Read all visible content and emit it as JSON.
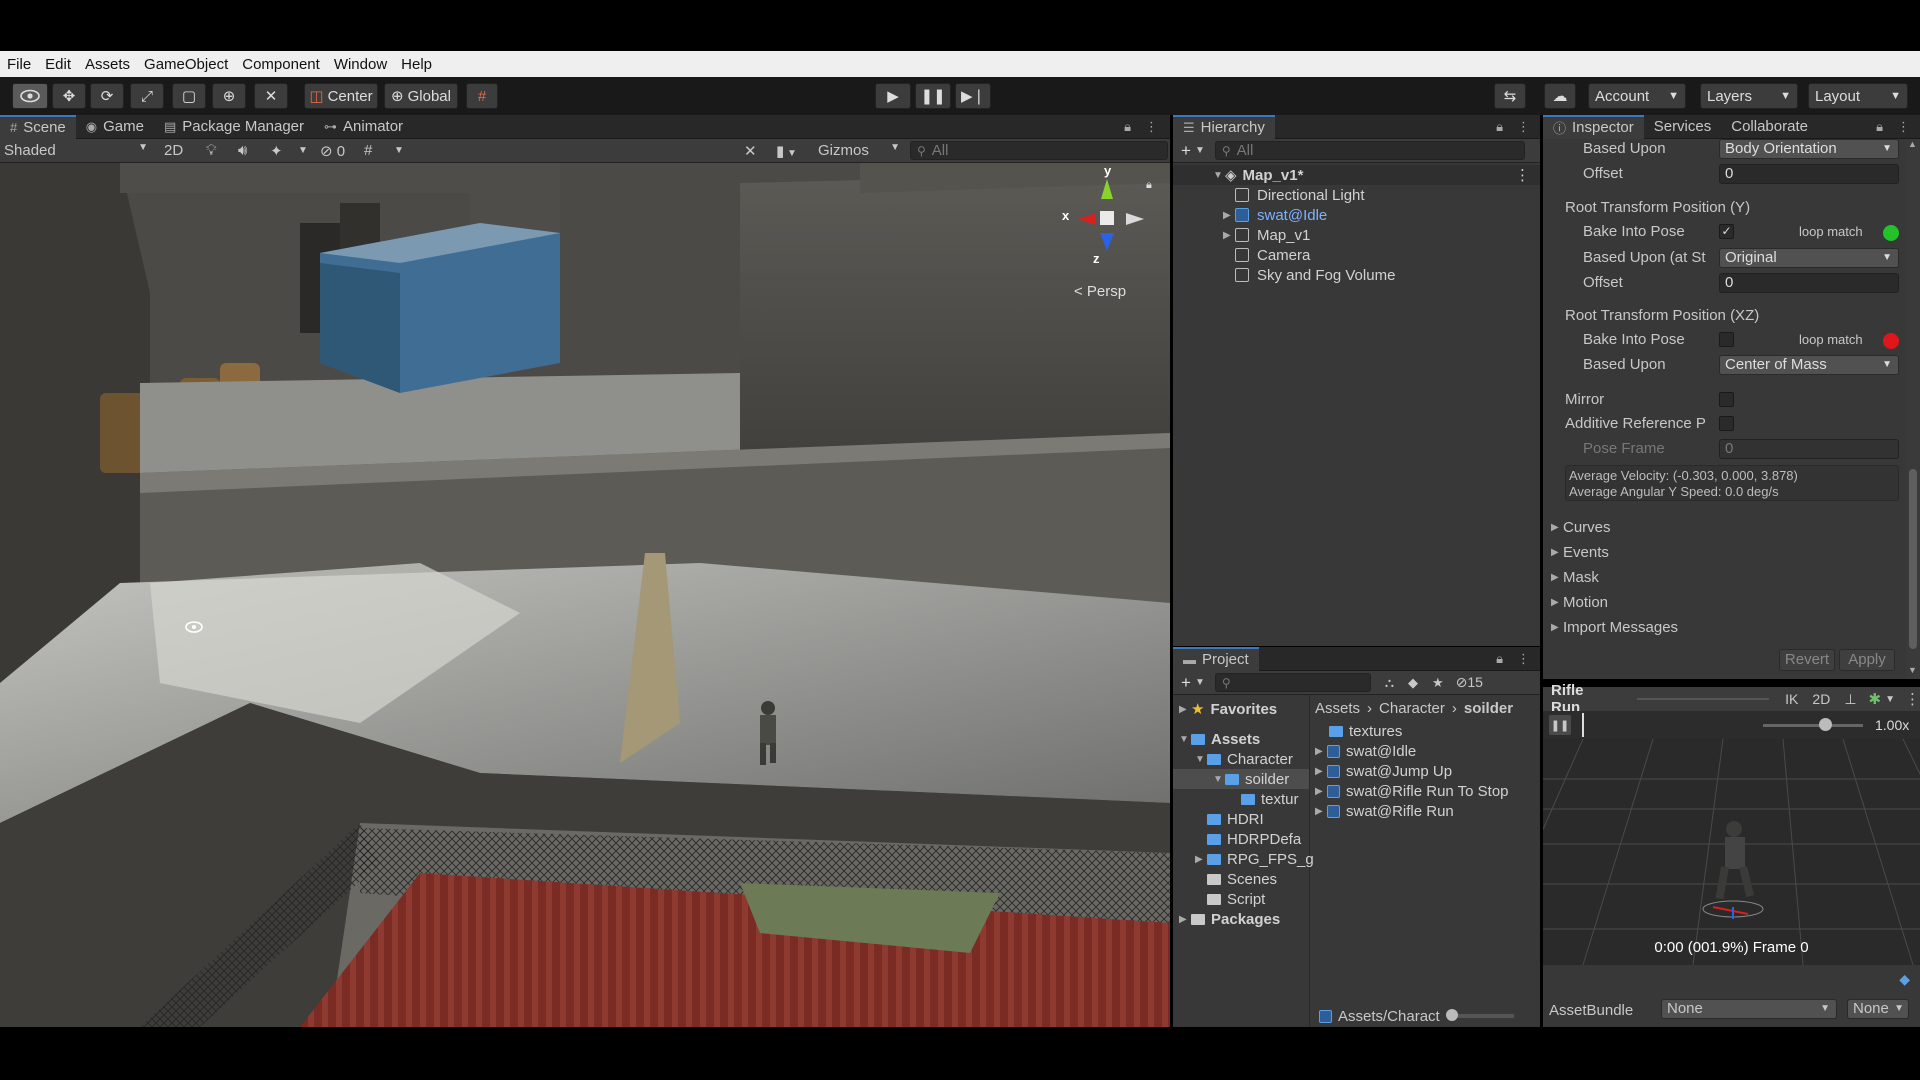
{
  "menubar": [
    "File",
    "Edit",
    "Assets",
    "GameObject",
    "Component",
    "Window",
    "Help"
  ],
  "toolbar": {
    "pivot": "Center",
    "space": "Global",
    "account": "Account",
    "layers": "Layers",
    "layout": "Layout"
  },
  "scene": {
    "tabs": [
      "Scene",
      "Game",
      "Package Manager",
      "Animator"
    ],
    "shading": "Shaded",
    "mode_2d": "2D",
    "hidden_count": "0",
    "gizmos": "Gizmos",
    "search_placeholder": "All",
    "gizmo_axes": {
      "x": "x",
      "y": "y",
      "z": "z"
    },
    "projection": "< Persp"
  },
  "hierarchy": {
    "title": "Hierarchy",
    "search_placeholder": "All",
    "scene_root": "Map_v1*",
    "items": [
      {
        "label": "Directional Light",
        "icon": "gameobject-icon"
      },
      {
        "label": "swat@Idle",
        "icon": "prefab-icon",
        "highlight": true
      },
      {
        "label": "Map_v1",
        "icon": "gameobject-icon"
      },
      {
        "label": "Camera",
        "icon": "gameobject-icon"
      },
      {
        "label": "Sky and Fog Volume",
        "icon": "gameobject-icon"
      }
    ]
  },
  "project": {
    "title": "Project",
    "hidden_count": "15",
    "favorites": "Favorites",
    "assets_root": "Assets",
    "tree": [
      {
        "label": "Character"
      },
      {
        "label": "soilder"
      },
      {
        "label": "textur"
      },
      {
        "label": "HDRI"
      },
      {
        "label": "HDRPDefa"
      },
      {
        "label": "RPG_FPS_g"
      },
      {
        "label": "Scenes"
      },
      {
        "label": "Script"
      }
    ],
    "packages": "Packages",
    "breadcrumb": [
      "Assets",
      "Character",
      "soilder"
    ],
    "files": [
      "textures",
      "swat@Idle",
      "swat@Jump Up",
      "swat@Rifle Run To Stop",
      "swat@Rifle Run"
    ],
    "path": "Assets/Charact"
  },
  "inspector": {
    "tabs": [
      "Inspector",
      "Services",
      "Collaborate"
    ],
    "based_upon_label": "Based Upon",
    "based_upon_value": "Body Orientation",
    "offset_label": "Offset",
    "offset_value": "0",
    "rtp_y_header": "Root Transform Position (Y)",
    "bake_label": "Bake Into Pose",
    "loop_match": "loop match",
    "based_upon_start_label": "Based Upon (at St",
    "based_upon_start_value": "Original",
    "offset2_value": "0",
    "rtp_xz_header": "Root Transform Position (XZ)",
    "bake2_label": "Bake Into Pose",
    "loop_match2": "loop match",
    "based_upon3_label": "Based Upon",
    "based_upon3_value": "Center of Mass",
    "mirror_label": "Mirror",
    "additive_label": "Additive Reference P",
    "pose_frame_label": "Pose Frame",
    "pose_frame_value": "0",
    "avg_velocity": "Average Velocity: (-0.303, 0.000, 3.878)",
    "avg_angular": "Average Angular Y Speed: 0.0 deg/s",
    "foldouts": [
      "Curves",
      "Events",
      "Mask",
      "Motion",
      "Import Messages"
    ],
    "revert": "Revert",
    "apply": "Apply",
    "colors": {
      "loop_ok": "#22c22a",
      "loop_bad": "#e0161c"
    }
  },
  "preview": {
    "title": "Rifle Run",
    "ik": "IK",
    "mode_2d": "2D",
    "speed": "1.00x",
    "progress": 0.019,
    "time_readout": "0:00 (001.9%) Frame 0"
  },
  "assetbundle": {
    "label": "AssetBundle",
    "value": "None",
    "variant": "None"
  }
}
